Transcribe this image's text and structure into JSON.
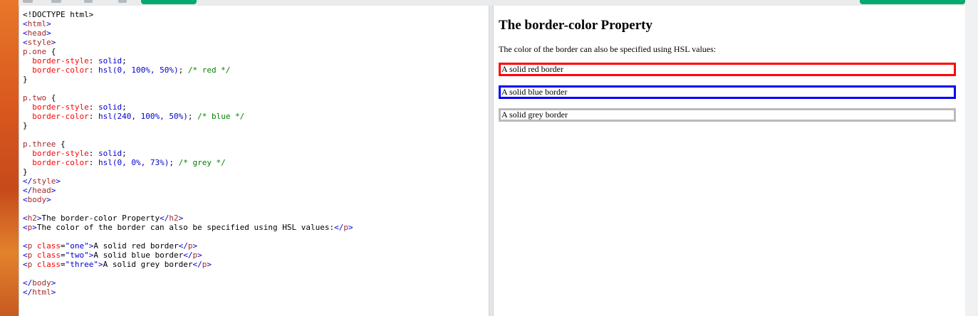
{
  "code_editor": {
    "lines": [
      [
        {
          "c": "plain",
          "t": "<!DOCTYPE html>"
        }
      ],
      [
        {
          "c": "bracket",
          "t": "<"
        },
        {
          "c": "tag",
          "t": "html"
        },
        {
          "c": "bracket",
          "t": ">"
        }
      ],
      [
        {
          "c": "bracket",
          "t": "<"
        },
        {
          "c": "tag",
          "t": "head"
        },
        {
          "c": "bracket",
          "t": ">"
        }
      ],
      [
        {
          "c": "bracket",
          "t": "<"
        },
        {
          "c": "tag",
          "t": "style"
        },
        {
          "c": "bracket",
          "t": ">"
        }
      ],
      [
        {
          "c": "selector",
          "t": "p.one"
        },
        {
          "c": "plain",
          "t": " {"
        }
      ],
      [
        {
          "c": "plain",
          "t": "  "
        },
        {
          "c": "prop",
          "t": "border-style"
        },
        {
          "c": "plain",
          "t": ": "
        },
        {
          "c": "val",
          "t": "solid"
        },
        {
          "c": "plain",
          "t": ";"
        }
      ],
      [
        {
          "c": "plain",
          "t": "  "
        },
        {
          "c": "prop",
          "t": "border-color"
        },
        {
          "c": "plain",
          "t": ": "
        },
        {
          "c": "val",
          "t": "hsl(0, 100%, 50%)"
        },
        {
          "c": "plain",
          "t": "; "
        },
        {
          "c": "comment",
          "t": "/* red */"
        }
      ],
      [
        {
          "c": "plain",
          "t": "}"
        }
      ],
      [
        {
          "c": "plain",
          "t": ""
        }
      ],
      [
        {
          "c": "selector",
          "t": "p.two"
        },
        {
          "c": "plain",
          "t": " {"
        }
      ],
      [
        {
          "c": "plain",
          "t": "  "
        },
        {
          "c": "prop",
          "t": "border-style"
        },
        {
          "c": "plain",
          "t": ": "
        },
        {
          "c": "val",
          "t": "solid"
        },
        {
          "c": "plain",
          "t": ";"
        }
      ],
      [
        {
          "c": "plain",
          "t": "  "
        },
        {
          "c": "prop",
          "t": "border-color"
        },
        {
          "c": "plain",
          "t": ": "
        },
        {
          "c": "val",
          "t": "hsl(240, 100%, 50%)"
        },
        {
          "c": "plain",
          "t": "; "
        },
        {
          "c": "comment",
          "t": "/* blue */"
        }
      ],
      [
        {
          "c": "plain",
          "t": "}"
        }
      ],
      [
        {
          "c": "plain",
          "t": ""
        }
      ],
      [
        {
          "c": "selector",
          "t": "p.three"
        },
        {
          "c": "plain",
          "t": " {"
        }
      ],
      [
        {
          "c": "plain",
          "t": "  "
        },
        {
          "c": "prop",
          "t": "border-style"
        },
        {
          "c": "plain",
          "t": ": "
        },
        {
          "c": "val",
          "t": "solid"
        },
        {
          "c": "plain",
          "t": ";"
        }
      ],
      [
        {
          "c": "plain",
          "t": "  "
        },
        {
          "c": "prop",
          "t": "border-color"
        },
        {
          "c": "plain",
          "t": ": "
        },
        {
          "c": "val",
          "t": "hsl(0, 0%, 73%)"
        },
        {
          "c": "plain",
          "t": "; "
        },
        {
          "c": "comment",
          "t": "/* grey */"
        }
      ],
      [
        {
          "c": "plain",
          "t": "}"
        }
      ],
      [
        {
          "c": "bracket",
          "t": "</"
        },
        {
          "c": "tag",
          "t": "style"
        },
        {
          "c": "bracket",
          "t": ">"
        }
      ],
      [
        {
          "c": "bracket",
          "t": "</"
        },
        {
          "c": "tag",
          "t": "head"
        },
        {
          "c": "bracket",
          "t": ">"
        }
      ],
      [
        {
          "c": "bracket",
          "t": "<"
        },
        {
          "c": "tag",
          "t": "body"
        },
        {
          "c": "bracket",
          "t": ">"
        }
      ],
      [
        {
          "c": "plain",
          "t": ""
        }
      ],
      [
        {
          "c": "bracket",
          "t": "<"
        },
        {
          "c": "tag",
          "t": "h2"
        },
        {
          "c": "bracket",
          "t": ">"
        },
        {
          "c": "plain",
          "t": "The border-color Property"
        },
        {
          "c": "bracket",
          "t": "</"
        },
        {
          "c": "tag",
          "t": "h2"
        },
        {
          "c": "bracket",
          "t": ">"
        }
      ],
      [
        {
          "c": "bracket",
          "t": "<"
        },
        {
          "c": "tag",
          "t": "p"
        },
        {
          "c": "bracket",
          "t": ">"
        },
        {
          "c": "plain",
          "t": "The color of the border can also be specified using HSL values:"
        },
        {
          "c": "bracket",
          "t": "</"
        },
        {
          "c": "tag",
          "t": "p"
        },
        {
          "c": "bracket",
          "t": ">"
        }
      ],
      [
        {
          "c": "plain",
          "t": ""
        }
      ],
      [
        {
          "c": "bracket",
          "t": "<"
        },
        {
          "c": "tag",
          "t": "p"
        },
        {
          "c": "plain",
          "t": " "
        },
        {
          "c": "attr",
          "t": "class"
        },
        {
          "c": "plain",
          "t": "="
        },
        {
          "c": "attrval",
          "t": "\"one\""
        },
        {
          "c": "bracket",
          "t": ">"
        },
        {
          "c": "plain",
          "t": "A solid red border"
        },
        {
          "c": "bracket",
          "t": "</"
        },
        {
          "c": "tag",
          "t": "p"
        },
        {
          "c": "bracket",
          "t": ">"
        }
      ],
      [
        {
          "c": "bracket",
          "t": "<"
        },
        {
          "c": "tag",
          "t": "p"
        },
        {
          "c": "plain",
          "t": " "
        },
        {
          "c": "attr",
          "t": "class"
        },
        {
          "c": "plain",
          "t": "="
        },
        {
          "c": "attrval",
          "t": "\"two\""
        },
        {
          "c": "bracket",
          "t": ">"
        },
        {
          "c": "plain",
          "t": "A solid blue border"
        },
        {
          "c": "bracket",
          "t": "</"
        },
        {
          "c": "tag",
          "t": "p"
        },
        {
          "c": "bracket",
          "t": ">"
        }
      ],
      [
        {
          "c": "bracket",
          "t": "<"
        },
        {
          "c": "tag",
          "t": "p"
        },
        {
          "c": "plain",
          "t": " "
        },
        {
          "c": "attr",
          "t": "class"
        },
        {
          "c": "plain",
          "t": "="
        },
        {
          "c": "attrval",
          "t": "\"three\""
        },
        {
          "c": "bracket",
          "t": ">"
        },
        {
          "c": "plain",
          "t": "A solid grey border"
        },
        {
          "c": "bracket",
          "t": "</"
        },
        {
          "c": "tag",
          "t": "p"
        },
        {
          "c": "bracket",
          "t": ">"
        }
      ],
      [
        {
          "c": "plain",
          "t": ""
        }
      ],
      [
        {
          "c": "bracket",
          "t": "</"
        },
        {
          "c": "tag",
          "t": "body"
        },
        {
          "c": "bracket",
          "t": ">"
        }
      ],
      [
        {
          "c": "bracket",
          "t": "</"
        },
        {
          "c": "tag",
          "t": "html"
        },
        {
          "c": "bracket",
          "t": ">"
        }
      ]
    ]
  },
  "preview": {
    "heading": "The border-color Property",
    "intro": "The color of the border can also be specified using HSL values:",
    "paragraphs": {
      "one": {
        "text": "A solid red border",
        "border_color": "#ff0000"
      },
      "two": {
        "text": "A solid blue border",
        "border_color": "#0000ff"
      },
      "three": {
        "text": "A solid grey border",
        "border_color": "#bababa"
      }
    }
  },
  "colors": {
    "accent_green": "#04aa6d",
    "wallpaper": "#d8571e"
  },
  "icons": [
    "menu-icon",
    "file-icon",
    "refresh-icon",
    "settings-icon"
  ]
}
